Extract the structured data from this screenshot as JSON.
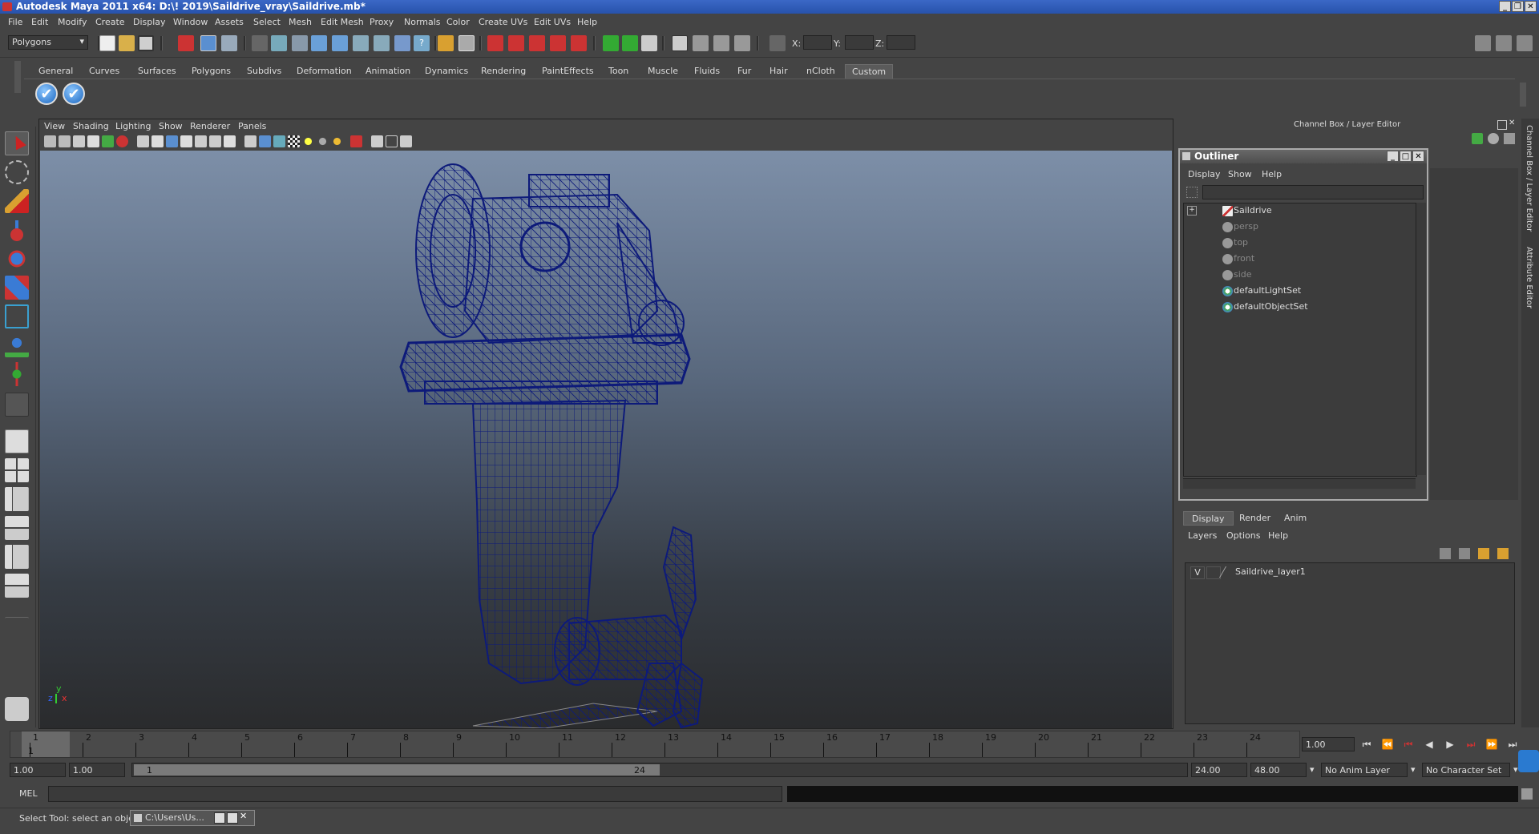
{
  "app": {
    "title": "Autodesk Maya 2011 x64: D:\\! 2019\\Saildrive_vray\\Saildrive.mb*",
    "menu": [
      "File",
      "Edit",
      "Modify",
      "Create",
      "Display",
      "Window",
      "Assets",
      "Select",
      "Mesh",
      "Edit Mesh",
      "Proxy",
      "Normals",
      "Color",
      "Create UVs",
      "Edit UVs",
      "Help"
    ]
  },
  "statusline": {
    "mode": "Polygons",
    "x_label": "X:",
    "y_label": "Y:",
    "z_label": "Z:"
  },
  "shelf": {
    "tabs": [
      "General",
      "Curves",
      "Surfaces",
      "Polygons",
      "Subdivs",
      "Deformation",
      "Animation",
      "Dynamics",
      "Rendering",
      "PaintEffects",
      "Toon",
      "Muscle",
      "Fluids",
      "Fur",
      "Hair",
      "nCloth",
      "Custom"
    ],
    "active_tab": "Custom",
    "check_glyph": "✔"
  },
  "viewport": {
    "menu": [
      "View",
      "Shading",
      "Lighting",
      "Show",
      "Renderer",
      "Panels"
    ],
    "axis_y": "y",
    "axis_x": "x",
    "axis_z": "z"
  },
  "channel_box": {
    "header": "Channel Box / Layer Editor",
    "side_tab_1": "Channel Box / Layer Editor",
    "side_tab_2": "Attribute Editor"
  },
  "outliner": {
    "title": "Outliner",
    "menu": [
      "Display",
      "Show",
      "Help"
    ],
    "expand_glyph": "+",
    "items": [
      {
        "label": "Saildrive",
        "dim": false,
        "icon": "mesh-transform-icon"
      },
      {
        "label": "persp",
        "dim": true,
        "icon": "camera-icon"
      },
      {
        "label": "top",
        "dim": true,
        "icon": "camera-icon"
      },
      {
        "label": "front",
        "dim": true,
        "icon": "camera-icon"
      },
      {
        "label": "side",
        "dim": true,
        "icon": "camera-icon"
      },
      {
        "label": "defaultLightSet",
        "dim": false,
        "icon": "set-icon"
      },
      {
        "label": "defaultObjectSet",
        "dim": false,
        "icon": "set-icon"
      }
    ]
  },
  "layer_editor": {
    "tabs": [
      "Display",
      "Render",
      "Anim"
    ],
    "active_tab": "Display",
    "menu": [
      "Layers",
      "Options",
      "Help"
    ],
    "layer": {
      "visibility": "V",
      "name": "Saildrive_layer1"
    }
  },
  "timeslider": {
    "frames": [
      "1",
      "2",
      "3",
      "4",
      "5",
      "6",
      "7",
      "8",
      "9",
      "10",
      "11",
      "12",
      "13",
      "14",
      "15",
      "16",
      "17",
      "18",
      "19",
      "20",
      "21",
      "22",
      "23",
      "24"
    ],
    "current_frame_marker": "1",
    "current_time": "1.00"
  },
  "range": {
    "start_time": "1.00",
    "playback_start": "1.00",
    "slider_start": "1",
    "slider_end": "24",
    "playback_end": "24.00",
    "end_time": "48.00",
    "anim_layer": "No Anim Layer",
    "character_set": "No Character Set"
  },
  "mel": {
    "label": "MEL"
  },
  "help": {
    "text": "Select Tool: select an object",
    "task_label": "C:\\Users\\Us..."
  }
}
